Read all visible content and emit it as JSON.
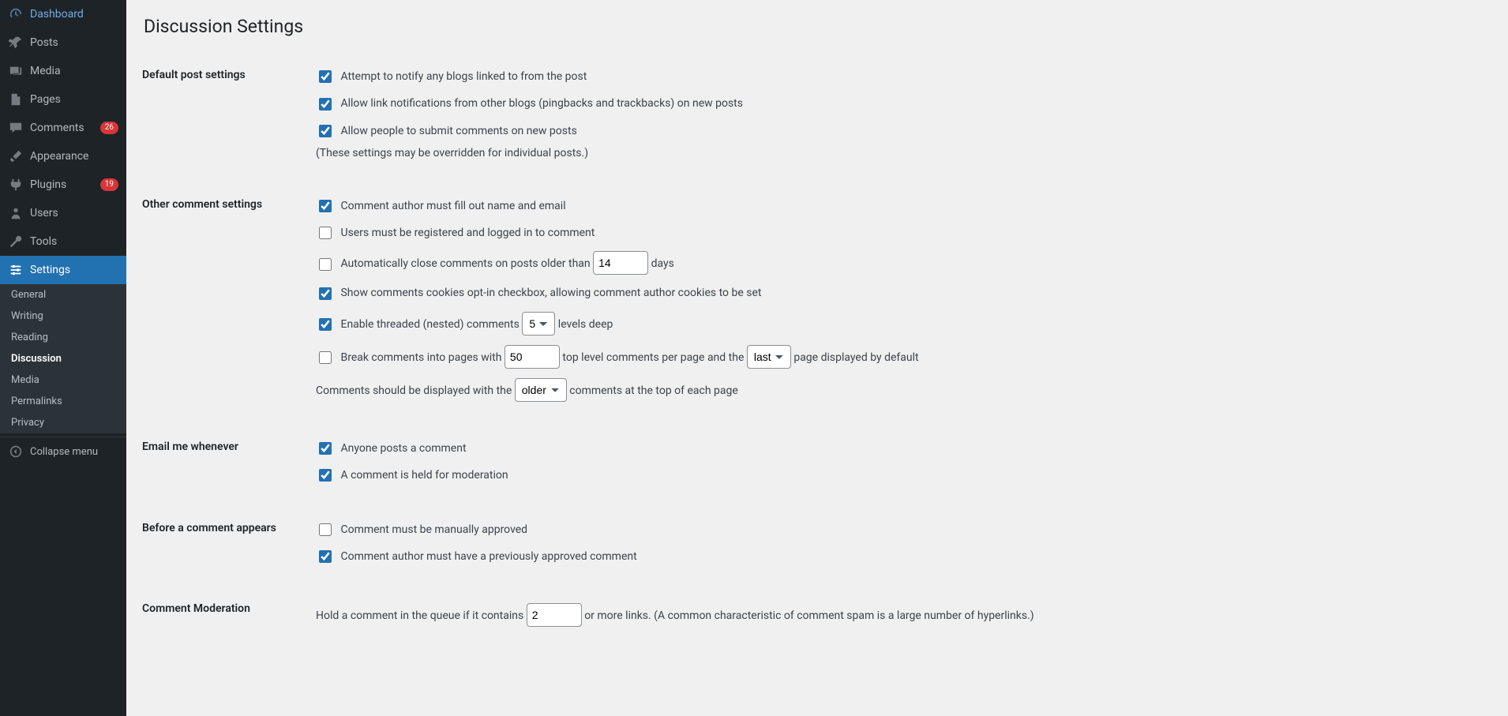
{
  "page": {
    "title": "Discussion Settings"
  },
  "sidebar": {
    "dashboard": "Dashboard",
    "posts": "Posts",
    "media": "Media",
    "pages": "Pages",
    "comments": "Comments",
    "comments_badge": "26",
    "appearance": "Appearance",
    "plugins": "Plugins",
    "plugins_badge": "19",
    "users": "Users",
    "tools": "Tools",
    "settings": "Settings",
    "settings_sub": {
      "general": "General",
      "writing": "Writing",
      "reading": "Reading",
      "discussion": "Discussion",
      "media": "Media",
      "permalinks": "Permalinks",
      "privacy": "Privacy"
    },
    "collapse": "Collapse menu"
  },
  "sections": {
    "default_post": {
      "heading": "Default post settings",
      "notify": "Attempt to notify any blogs linked to from the post",
      "pingback": "Allow link notifications from other blogs (pingbacks and trackbacks) on new posts",
      "allow_comments": "Allow people to submit comments on new posts",
      "hint": "(These settings may be overridden for individual posts.)"
    },
    "other": {
      "heading": "Other comment settings",
      "author_fill": "Comment author must fill out name and email",
      "registered": "Users must be registered and logged in to comment",
      "autoclose_pre": "Automatically close comments on posts older than ",
      "autoclose_days_value": "14",
      "autoclose_post": " days",
      "optin": "Show comments cookies opt-in checkbox, allowing comment author cookies to be set",
      "threaded_pre": "Enable threaded (nested) comments ",
      "threaded_select": "5",
      "threaded_post": " levels deep",
      "break_pre": "Break comments into pages with ",
      "break_value": "50",
      "break_mid1": " top level comments per page and the ",
      "break_select": "last",
      "break_mid2": " page displayed by default",
      "order_pre": "Comments should be displayed with the ",
      "order_select": "older",
      "order_post": " comments at the top of each page"
    },
    "email": {
      "heading": "Email me whenever",
      "anyone": "Anyone posts a comment",
      "held": "A comment is held for moderation"
    },
    "before": {
      "heading": "Before a comment appears",
      "manual": "Comment must be manually approved",
      "prev": "Comment author must have a previously approved comment"
    },
    "moderation": {
      "heading": "Comment Moderation",
      "links_pre": "Hold a comment in the queue if it contains ",
      "links_value": "2",
      "links_post": " or more links. (A common characteristic of comment spam is a large number of hyperlinks.)"
    }
  }
}
